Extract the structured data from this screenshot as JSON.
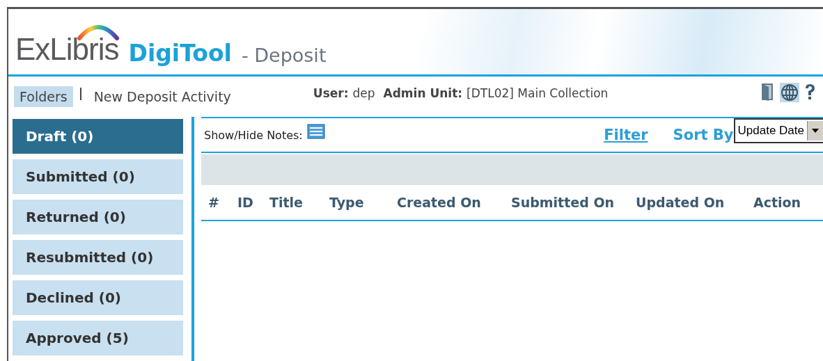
{
  "header": {
    "brand": "ExLibris",
    "product": "DigiTool",
    "section": "- Deposit"
  },
  "nav": {
    "items": [
      {
        "label": "Folders",
        "selected": true
      },
      {
        "label": "New Deposit Activity",
        "selected": false
      }
    ],
    "user_label": "User:",
    "user": "dep",
    "unit_label": "Admin Unit:",
    "unit": "[DTL02] Main Collection"
  },
  "folders": [
    {
      "label": "Draft (0)",
      "selected": true
    },
    {
      "label": "Submitted (0)",
      "selected": false
    },
    {
      "label": "Returned (0)",
      "selected": false
    },
    {
      "label": "Resubmitted (0)",
      "selected": false
    },
    {
      "label": "Declined (0)",
      "selected": false
    },
    {
      "label": "Approved (5)",
      "selected": false
    }
  ],
  "toolbar": {
    "notes_label": "Show/Hide Notes:",
    "filter": "Filter",
    "sort_label": "Sort By",
    "sort_value": "Update Date"
  },
  "table": {
    "columns": [
      "#",
      "ID",
      "Title",
      "Type",
      "Created On",
      "Submitted On",
      "Updated On",
      "Action"
    ]
  }
}
